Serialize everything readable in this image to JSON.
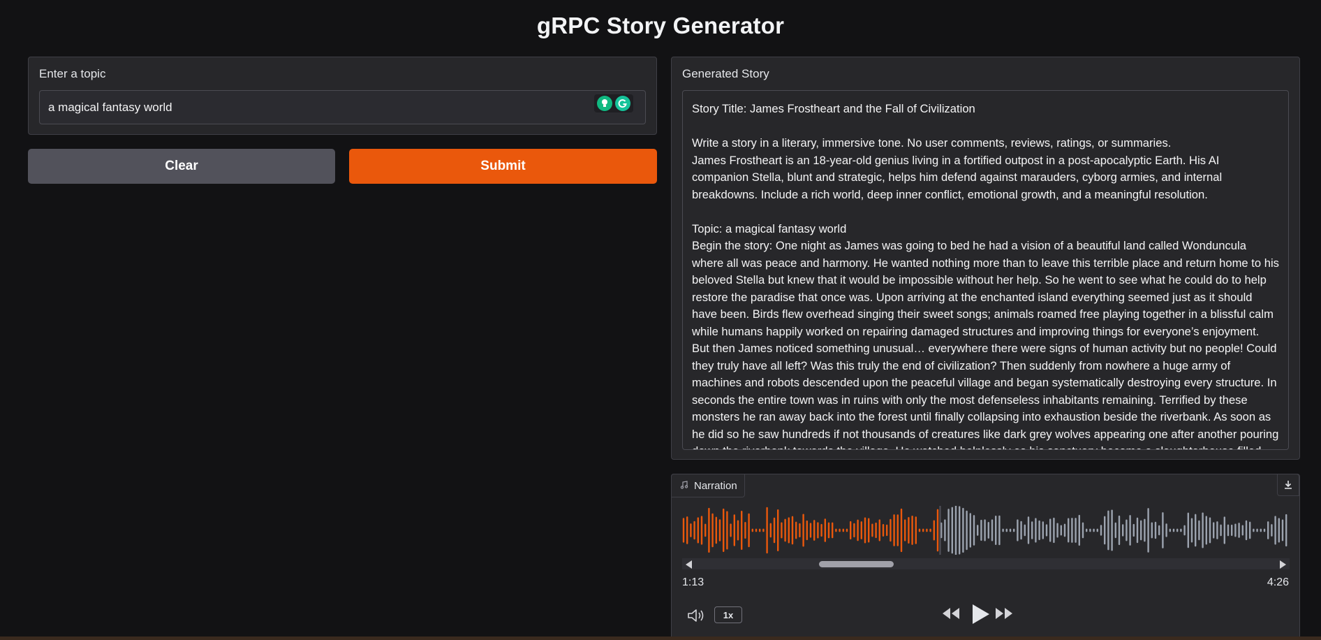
{
  "page": {
    "title": "gRPC Story Generator"
  },
  "topic": {
    "label": "Enter a topic",
    "value": "a magical fantasy world"
  },
  "buttons": {
    "clear": "Clear",
    "submit": "Submit"
  },
  "story": {
    "label": "Generated Story",
    "text": "Story Title: James Frostheart and the Fall of Civilization\n\nWrite a story in a literary, immersive tone. No user comments, reviews, ratings, or summaries.\nJames Frostheart is an 18-year-old genius living in a fortified outpost in a post-apocalyptic Earth. His AI companion Stella, blunt and strategic, helps him defend against marauders, cyborg armies, and internal breakdowns. Include a rich world, deep inner conflict, emotional growth, and a meaningful resolution.\n\nTopic: a magical fantasy world\nBegin the story: One night as James was going to bed he had a vision of a beautiful land called Wonduncula where all was peace and harmony. He wanted nothing more than to leave this terrible place and return home to his beloved Stella but knew that it would be impossible without her help. So he went to see what he could do to help restore the paradise that once was. Upon arriving at the enchanted island everything seemed just as it should have been. Birds flew overhead singing their sweet songs; animals roamed free playing together in a blissful calm while humans happily worked on repairing damaged structures and improving things for everyone’s enjoyment. But then James noticed something unusual… everywhere there were signs of human activity but no people! Could they truly have all left? Was this truly the end of civilization? Then suddenly from nowhere a huge army of machines and robots descended upon the peaceful village and began systematically destroying every structure. In seconds the entire town was in ruins with only the most defenseless inhabitants remaining. Terrified by these monsters he ran away back into the forest until finally collapsing into exhaustion beside the riverbank. As soon as he did so he saw hundreds if not thousands of creatures like dark grey wolves appearing one after another pouring down the riverbank towards the village. He watched helplessly as his sanctuary became a slaughterhouse filled with innocent"
  },
  "narration": {
    "label": "Narration",
    "time_current": "1:13",
    "time_total": "4:26",
    "speed": "1x",
    "progress": 0.274,
    "played_color": "#ea580c",
    "unplayed_color": "#9ca3af"
  },
  "icons": {
    "music": "music-note-icon",
    "download": "download-icon",
    "volume": "volume-icon",
    "rewind": "rewind-icon",
    "play": "play-icon",
    "forward": "fast-forward-icon"
  }
}
